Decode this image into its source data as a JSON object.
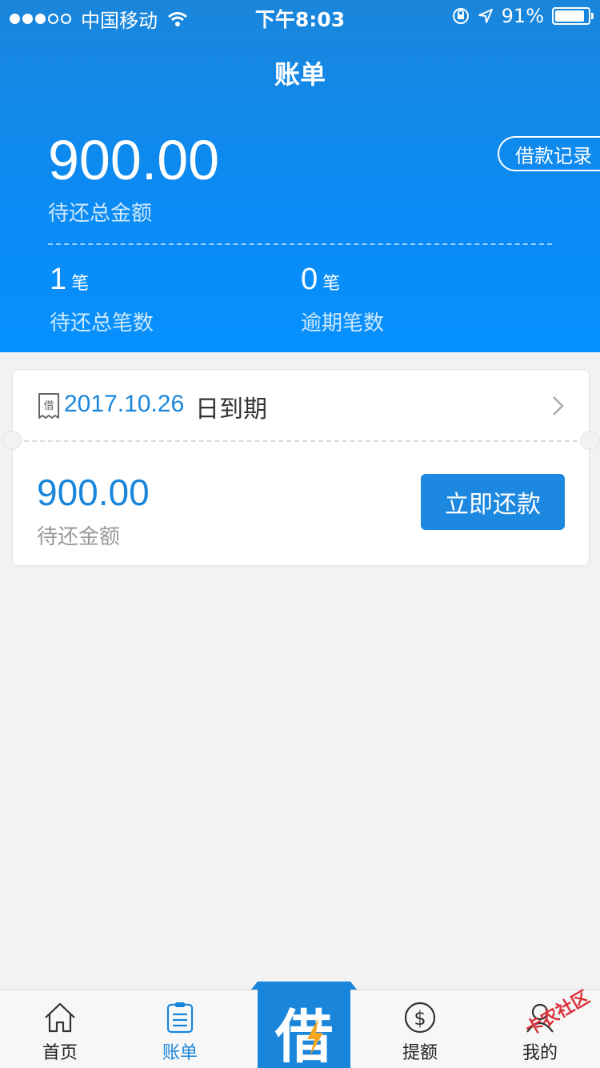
{
  "status_bar": {
    "carrier": "中国移动",
    "time": "下午8:03",
    "battery": "91%"
  },
  "title": "账单",
  "summary": {
    "total_amount": "900.00",
    "total_label": "待还总金额",
    "loan_record_button": "借款记录",
    "pending_count": "1",
    "pending_unit": "笔",
    "pending_label": "待还总笔数",
    "overdue_count": "0",
    "overdue_unit": "笔",
    "overdue_label": "逾期笔数"
  },
  "bill_card": {
    "icon_text": "借",
    "due_date": "2017.10.26",
    "due_suffix": "日到期",
    "amount": "900.00",
    "amount_label": "待还金额",
    "repay_button": "立即还款"
  },
  "tabbar": {
    "items": [
      {
        "label": "首页",
        "icon": "home-icon"
      },
      {
        "label": "账单",
        "icon": "bill-icon",
        "active": true
      },
      {
        "label": "借",
        "icon": "borrow-icon"
      },
      {
        "label": "提额",
        "icon": "dollar-icon"
      },
      {
        "label": "我的",
        "icon": "user-icon"
      }
    ],
    "watermark": "卡农社区"
  },
  "colors": {
    "primary": "#1a86db",
    "header_bottom": "#0691ff",
    "background": "#f2f2f2"
  }
}
